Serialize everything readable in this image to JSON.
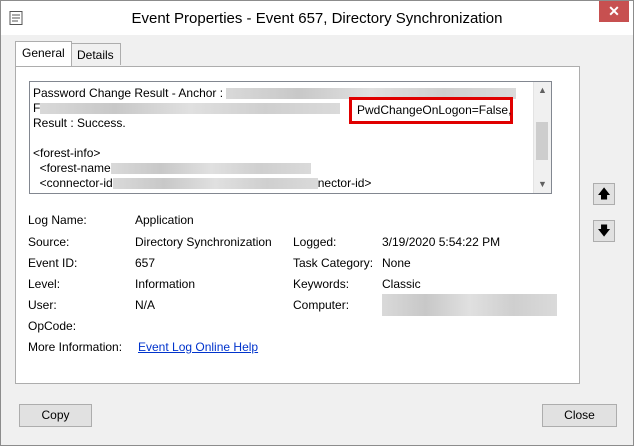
{
  "window": {
    "title": "Event Properties - Event 657, Directory Synchronization",
    "close_glyph": "✕"
  },
  "tabs": [
    {
      "label": "General",
      "active": true
    },
    {
      "label": "Details",
      "active": false
    }
  ],
  "description": {
    "line1": "Password Change Result - Anchor : ",
    "line2_prefix": "F",
    "line3": "Result : Success.",
    "line4": "<forest-info>",
    "line5": "  <forest-name",
    "line6_prefix": "  <connector-id",
    "line6_suffix": "nector-id>",
    "highlighted": "PwdChangeOnLogon=False,"
  },
  "fields": {
    "log_name_label": "Log Name:",
    "log_name_value": "Application",
    "source_label": "Source:",
    "source_value": "Directory Synchronization",
    "logged_label": "Logged:",
    "logged_value": "3/19/2020 5:54:22 PM",
    "event_id_label": "Event ID:",
    "event_id_value": "657",
    "task_category_label": "Task Category:",
    "task_category_value": "None",
    "level_label": "Level:",
    "level_value": "Information",
    "keywords_label": "Keywords:",
    "keywords_value": "Classic",
    "user_label": "User:",
    "user_value": "N/A",
    "computer_label": "Computer:",
    "opcode_label": "OpCode:",
    "more_info_label": "More Information:",
    "more_info_link": "Event Log Online Help"
  },
  "nav": {
    "up_glyph": "🡅",
    "down_glyph": "🡇"
  },
  "buttons": {
    "copy": "Copy",
    "close": "Close"
  },
  "scroll": {
    "up_glyph": "▲",
    "down_glyph": "▼"
  }
}
